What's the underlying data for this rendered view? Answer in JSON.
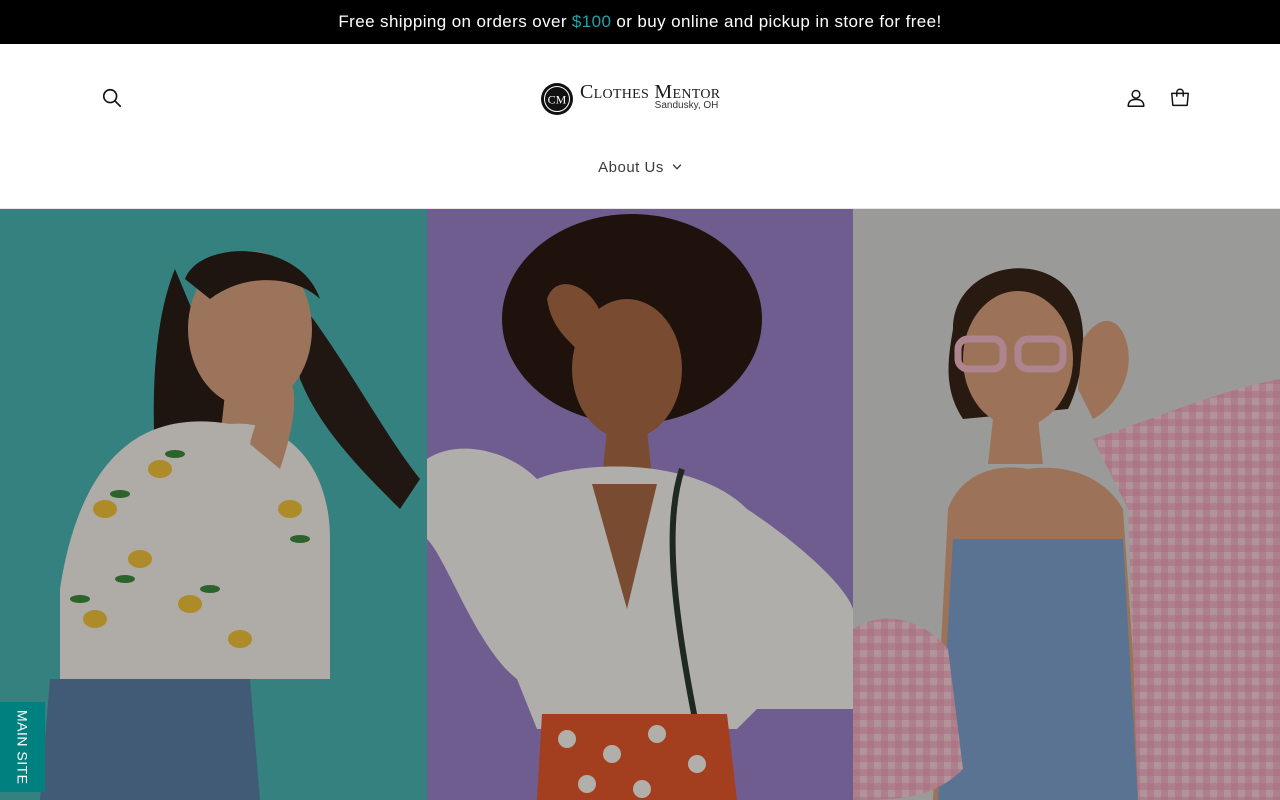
{
  "announcement": {
    "text_before": "Free shipping on orders over",
    "accent_text": "$100",
    "text_after": "or buy online and pickup in store for free!",
    "accent_color": "#1fa3a6"
  },
  "header": {
    "logo": {
      "name": "Clothes Mentor",
      "location": "Sandusky, OH",
      "mark": "CM"
    },
    "icons": {
      "search": "search-icon",
      "account": "account-icon",
      "cart": "cart-icon"
    }
  },
  "nav": {
    "items": [
      {
        "label": "About Us",
        "icon": "chevron-down-icon"
      }
    ]
  },
  "hero": {
    "panels": [
      {
        "background": "#48b3b0",
        "description": "lemon-print-blouse"
      },
      {
        "background": "#9a82c8",
        "description": "white-blouse-polka-dot-skirt"
      },
      {
        "background": "#d6d7d4",
        "description": "pink-gingham-shirt-blue-dress"
      }
    ]
  },
  "floating_tab": {
    "label": "MAIN SITE",
    "color": "#00807f"
  }
}
